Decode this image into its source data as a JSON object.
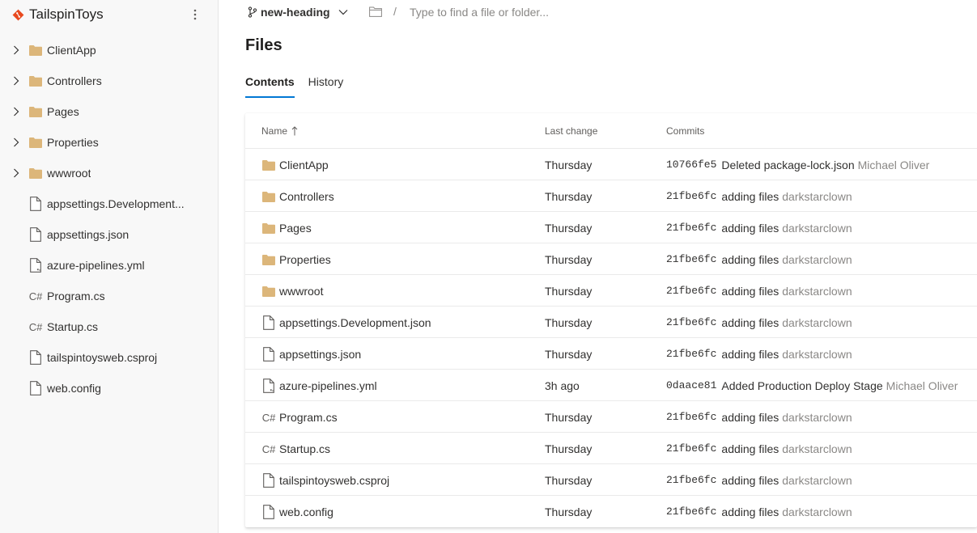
{
  "repo": {
    "name": "TailspinToys",
    "more_icon": "more-vertical-icon",
    "brand_color": "#e8491e"
  },
  "tree": [
    {
      "label": "ClientApp",
      "type": "folder"
    },
    {
      "label": "Controllers",
      "type": "folder"
    },
    {
      "label": "Pages",
      "type": "folder"
    },
    {
      "label": "Properties",
      "type": "folder"
    },
    {
      "label": "wwwroot",
      "type": "folder"
    },
    {
      "label": "appsettings.Development...",
      "type": "file"
    },
    {
      "label": "appsettings.json",
      "type": "file"
    },
    {
      "label": "azure-pipelines.yml",
      "type": "yml"
    },
    {
      "label": "Program.cs",
      "type": "cs"
    },
    {
      "label": "Startup.cs",
      "type": "cs"
    },
    {
      "label": "tailspintoysweb.csproj",
      "type": "file"
    },
    {
      "label": "web.config",
      "type": "file"
    }
  ],
  "topbar": {
    "branch": "new-heading",
    "path_placeholder": "Type to find a file or folder...",
    "separator": "/"
  },
  "page": {
    "title": "Files",
    "tabs": [
      {
        "label": "Contents",
        "active": true
      },
      {
        "label": "History",
        "active": false
      }
    ]
  },
  "table": {
    "headers": {
      "name": "Name",
      "last_change": "Last change",
      "commits": "Commits"
    },
    "rows": [
      {
        "name": "ClientApp",
        "type": "folder",
        "last_change": "Thursday",
        "hash": "10766fe5",
        "message": "Deleted package-lock.json",
        "author": "Michael Oliver"
      },
      {
        "name": "Controllers",
        "type": "folder",
        "last_change": "Thursday",
        "hash": "21fbe6fc",
        "message": "adding files",
        "author": "darkstarclown"
      },
      {
        "name": "Pages",
        "type": "folder",
        "last_change": "Thursday",
        "hash": "21fbe6fc",
        "message": "adding files",
        "author": "darkstarclown"
      },
      {
        "name": "Properties",
        "type": "folder",
        "last_change": "Thursday",
        "hash": "21fbe6fc",
        "message": "adding files",
        "author": "darkstarclown"
      },
      {
        "name": "wwwroot",
        "type": "folder",
        "last_change": "Thursday",
        "hash": "21fbe6fc",
        "message": "adding files",
        "author": "darkstarclown"
      },
      {
        "name": "appsettings.Development.json",
        "type": "file",
        "last_change": "Thursday",
        "hash": "21fbe6fc",
        "message": "adding files",
        "author": "darkstarclown"
      },
      {
        "name": "appsettings.json",
        "type": "file",
        "last_change": "Thursday",
        "hash": "21fbe6fc",
        "message": "adding files",
        "author": "darkstarclown"
      },
      {
        "name": "azure-pipelines.yml",
        "type": "yml",
        "last_change": "3h ago",
        "hash": "0daace81",
        "message": "Added Production Deploy Stage",
        "author": "Michael Oliver"
      },
      {
        "name": "Program.cs",
        "type": "cs",
        "last_change": "Thursday",
        "hash": "21fbe6fc",
        "message": "adding files",
        "author": "darkstarclown"
      },
      {
        "name": "Startup.cs",
        "type": "cs",
        "last_change": "Thursday",
        "hash": "21fbe6fc",
        "message": "adding files",
        "author": "darkstarclown"
      },
      {
        "name": "tailspintoysweb.csproj",
        "type": "file",
        "last_change": "Thursday",
        "hash": "21fbe6fc",
        "message": "adding files",
        "author": "darkstarclown"
      },
      {
        "name": "web.config",
        "type": "file",
        "last_change": "Thursday",
        "hash": "21fbe6fc",
        "message": "adding files",
        "author": "darkstarclown"
      }
    ]
  },
  "icons": {
    "cs_glyph": "C#"
  },
  "colors": {
    "folder": "#dcb67a",
    "accent": "#0078d4",
    "muted": "#8a8886"
  }
}
